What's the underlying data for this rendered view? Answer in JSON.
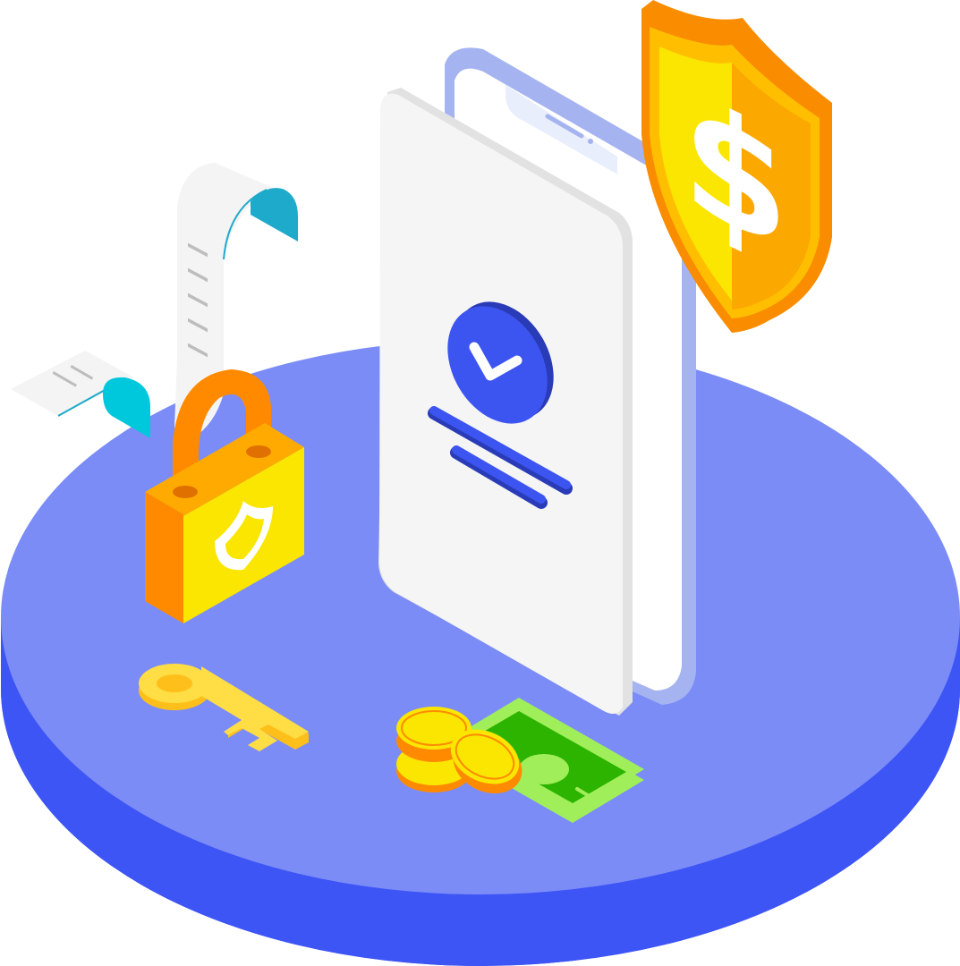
{
  "illustration": {
    "shield_symbol": "$",
    "icons": [
      "platform",
      "phone",
      "check-icon",
      "shield-dollar-icon",
      "receipt-icon",
      "padlock-icon",
      "key-icon",
      "coins-icon",
      "banknote-icon"
    ]
  },
  "colors": {
    "platform_top": "#7b8cf7",
    "platform_side": "#3e55f6",
    "accent_blue": "#3d55f0",
    "phone_face": "#f5f5f5",
    "phone_back": "#a5b4f0",
    "shield_orange": "#fa8c00",
    "shield_yellow": "#fae600",
    "lock_orange": "#ff8a00",
    "lock_yellow": "#fae600",
    "receipt_teal": "#1eaacb",
    "money_green": "#2db400",
    "money_light": "#a0ef5a",
    "coin_yellow": "#fae600"
  }
}
